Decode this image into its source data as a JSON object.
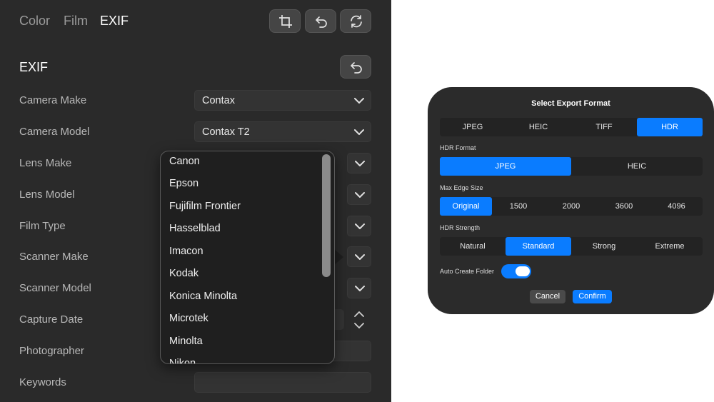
{
  "header": {
    "tabs": [
      {
        "label": "Color",
        "active": false
      },
      {
        "label": "Film",
        "active": false
      },
      {
        "label": "EXIF",
        "active": true
      }
    ],
    "tools": [
      "crop-icon",
      "undo-icon",
      "refresh-icon"
    ]
  },
  "exif": {
    "title": "EXIF",
    "reset_icon": "undo-icon",
    "fields": [
      {
        "label": "Camera Make",
        "value": "Contax",
        "type": "select"
      },
      {
        "label": "Camera Model",
        "value": "Contax T2",
        "type": "select"
      },
      {
        "label": "Lens Make",
        "value": "",
        "type": "select"
      },
      {
        "label": "Lens Model",
        "value": "",
        "type": "select"
      },
      {
        "label": "Film Type",
        "value": "",
        "type": "select"
      },
      {
        "label": "Scanner Make",
        "value": "",
        "type": "select"
      },
      {
        "label": "Scanner Model",
        "value": "",
        "type": "select"
      },
      {
        "label": "Capture Date",
        "value": "",
        "type": "date"
      },
      {
        "label": "Photographer",
        "value": "",
        "type": "text"
      },
      {
        "label": "Keywords",
        "value": "",
        "type": "text"
      }
    ]
  },
  "dropdown": {
    "items": [
      "Canon",
      "Epson",
      "Fujifilm Frontier",
      "Hasselblad",
      "Imacon",
      "Kodak",
      "Konica Minolta",
      "Microtek",
      "Minolta",
      "Nikon"
    ]
  },
  "export_dialog": {
    "title": "Select Export Format",
    "formats": {
      "options": [
        "JPEG",
        "HEIC",
        "TIFF",
        "HDR"
      ],
      "selected": "HDR"
    },
    "hdr_format": {
      "label": "HDR Format",
      "options": [
        "JPEG",
        "HEIC"
      ],
      "selected": "JPEG"
    },
    "max_edge_size": {
      "label": "Max Edge Size",
      "options": [
        "Original",
        "1500",
        "2000",
        "3600",
        "4096"
      ],
      "selected": "Original"
    },
    "hdr_strength": {
      "label": "HDR Strength",
      "options": [
        "Natural",
        "Standard",
        "Strong",
        "Extreme"
      ],
      "selected": "Standard"
    },
    "auto_create_folder": {
      "label": "Auto Create Folder",
      "on": true
    },
    "cancel_label": "Cancel",
    "confirm_label": "Confirm"
  },
  "colors": {
    "accent": "#0a7cff",
    "panel_bg": "#2a2a2a",
    "dialog_bg": "#2b2b2b"
  }
}
